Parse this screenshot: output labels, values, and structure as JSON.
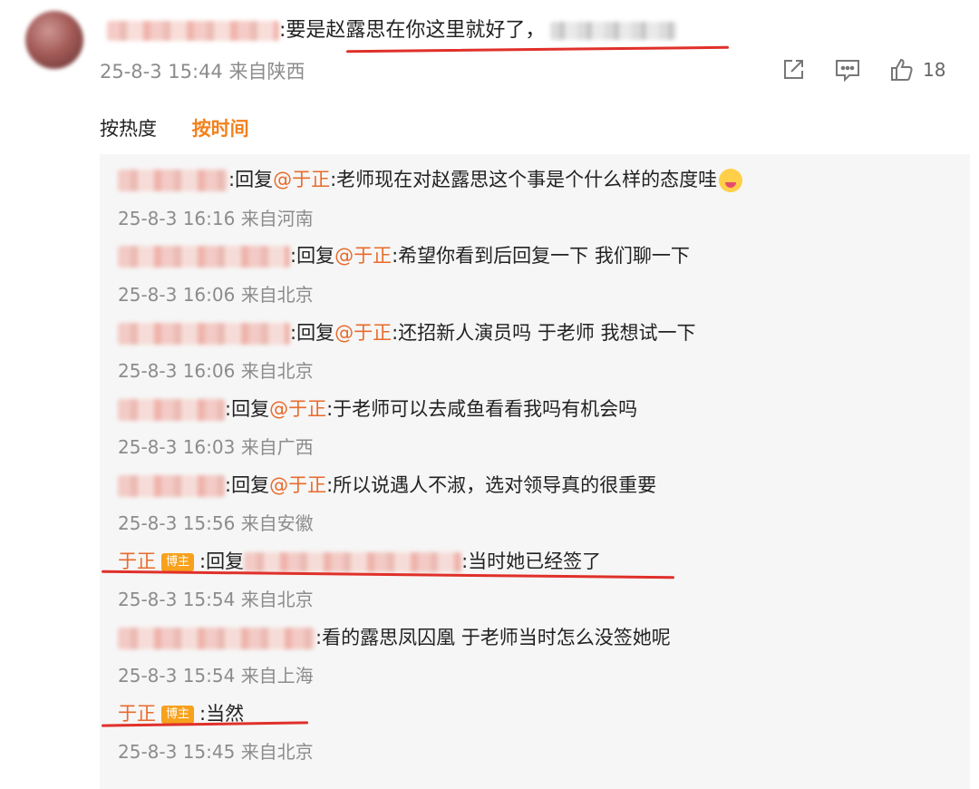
{
  "main_comment": {
    "text": ":要是赵露思在你这里就好了，",
    "time": "25-8-3 15:44",
    "location": "来自陕西",
    "like_count": "18"
  },
  "icons": {
    "share": "share-icon",
    "comment": "comment-icon",
    "like": "thumbs-up-icon"
  },
  "sort": {
    "hot": "按热度",
    "time": "按时间"
  },
  "replies": [
    {
      "prefix": ":回复",
      "at": "@于正",
      "text": ":老师现在对赵露思这个事是个什么样的态度哇",
      "time": "25-8-3 16:16",
      "location": "来自河南"
    },
    {
      "prefix": ":回复",
      "at": "@于正",
      "text": ":希望你看到后回复一下  我们聊一下",
      "time": "25-8-3 16:06",
      "location": "来自北京"
    },
    {
      "prefix": ":回复",
      "at": "@于正",
      "text": ":还招新人演员吗  于老师  我想试一下",
      "time": "25-8-3 16:06",
      "location": "来自北京"
    },
    {
      "prefix": ":回复",
      "at": "@于正",
      "text": ":于老师可以去咸鱼看看我吗有机会吗",
      "time": "25-8-3 16:03",
      "location": "来自广西"
    },
    {
      "prefix": ":回复",
      "at": "@于正",
      "text": ":所以说遇人不淑，选对领导真的很重要",
      "time": "25-8-3 15:56",
      "location": "来自安徽"
    },
    {
      "author": "于正",
      "badge": "博主",
      "prefix": ":回复",
      "text": ":当时她已经签了",
      "time": "25-8-3 15:54",
      "location": "来自北京"
    },
    {
      "text": ":看的露思凤囚凰  于老师当时怎么没签她呢",
      "time": "25-8-3 15:54",
      "location": "来自上海"
    },
    {
      "author": "于正",
      "badge": "博主",
      "text": ":当然",
      "time": "25-8-3 15:45",
      "location": "来自北京"
    }
  ]
}
